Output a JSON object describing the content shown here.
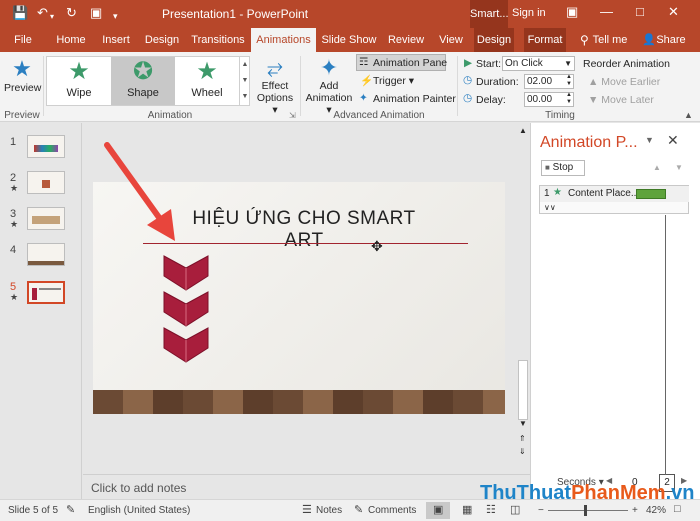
{
  "titlebar": {
    "title": "Presentation1  -  PowerPoint",
    "context_tab": "Smart...",
    "signin": "Sign in",
    "qa_icons": [
      "save-icon",
      "undo-icon",
      "redo-icon",
      "present-icon",
      "customize-icon"
    ]
  },
  "tabs": [
    {
      "label": "File"
    },
    {
      "label": "Home"
    },
    {
      "label": "Insert"
    },
    {
      "label": "Design"
    },
    {
      "label": "Transitions"
    },
    {
      "label": "Animations"
    },
    {
      "label": "Slide Show"
    },
    {
      "label": "Review"
    },
    {
      "label": "View"
    },
    {
      "label": "Design"
    },
    {
      "label": "Format"
    },
    {
      "label": "Tell me"
    },
    {
      "label": "Share"
    }
  ],
  "active_tab": "Animations",
  "ribbon": {
    "preview": {
      "label": "Preview",
      "group": "Preview"
    },
    "animation_group": "Animation",
    "gallery": [
      {
        "label": "Wipe"
      },
      {
        "label": "Shape"
      },
      {
        "label": "Wheel"
      }
    ],
    "selected_effect": "Shape",
    "effect_options": [
      "Effect",
      "Options ▾"
    ],
    "add_animation": [
      "Add",
      "Animation ▾"
    ],
    "advanced_group": "Advanced Animation",
    "animation_pane": "Animation Pane",
    "trigger": "Trigger ▾",
    "animation_painter": "Animation Painter",
    "timing": {
      "group": "Timing",
      "start_label": "Start:",
      "start_value": "On Click",
      "duration_label": "Duration:",
      "duration_value": "02.00",
      "delay_label": "Delay:",
      "delay_value": "00.00",
      "reorder": "Reorder Animation",
      "move_earlier": "▲ Move Earlier",
      "move_later": "▼ Move Later"
    }
  },
  "thumbnails": [
    {
      "num": "1",
      "star": ""
    },
    {
      "num": "2",
      "star": "★"
    },
    {
      "num": "3",
      "star": "★"
    },
    {
      "num": "4",
      "star": ""
    },
    {
      "num": "5",
      "star": "★"
    }
  ],
  "current_slide": "5",
  "slide": {
    "title": "HIỆU ỨNG CHO SMART ART"
  },
  "notes_placeholder": "Click to add notes",
  "animation_pane": {
    "title": "Animation P...",
    "stop": "Stop",
    "item_index": "1",
    "item_label": "Content Place...",
    "seconds_label": "Seconds ▾",
    "timeline_ticks": [
      "0",
      "2"
    ]
  },
  "statusbar": {
    "slide_info": "Slide 5 of 5",
    "language": "English (United States)",
    "notes": "Notes",
    "comments": "Comments",
    "zoom": "42%"
  },
  "watermark": {
    "part1": "ThuThuat",
    "part2": "PhanMem",
    ".vn": ".vn"
  },
  "colors": {
    "accent": "#b7472a",
    "accent_dark": "#95351d",
    "effect_star": "#3d9a6a",
    "arrow": "#e8453c",
    "smartart": "#a81e3c",
    "bar": "#5ea33c"
  }
}
